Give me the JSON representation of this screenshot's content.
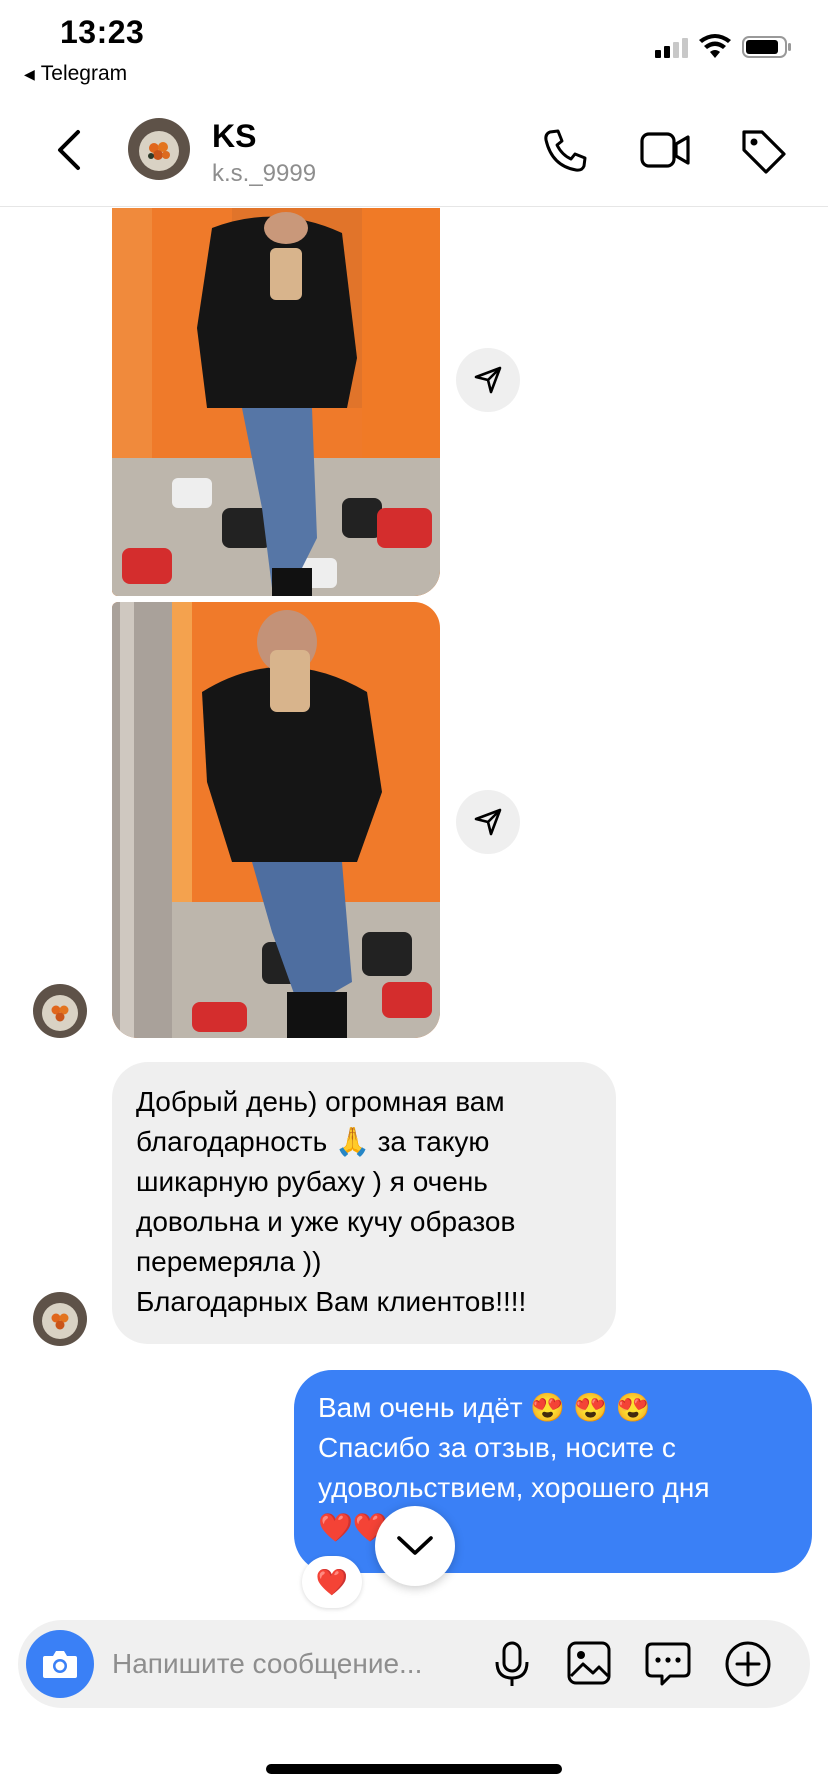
{
  "status_bar": {
    "time": "13:23",
    "back_app": "Telegram"
  },
  "header": {
    "name": "KS",
    "handle": "k.s._9999"
  },
  "messages": {
    "incoming_lines": [
      "Добрый день) огромная вам",
      "благодарность 🙏 за такую",
      "шикарную рубаху ) я очень",
      "довольна и уже кучу образов",
      "перемеряла ))",
      "Благодарных Вам клиентов!!!!"
    ],
    "outgoing_lines": [
      "Вам очень идёт 😍 😍 😍",
      "Спасибо за отзыв, носите с",
      "удовольствием, хорошего дня",
      "❤️❤️❤️"
    ],
    "reaction": "❤️"
  },
  "composer": {
    "placeholder": "Напишите сообщение..."
  },
  "colors": {
    "accent": "#3a80f6",
    "incoming_bubble": "#efefef",
    "muted_text": "#8e8e8e"
  },
  "icons": [
    "back-chevron-icon",
    "phone-icon",
    "video-call-icon",
    "tag-icon",
    "share-icon",
    "chevron-down-icon",
    "camera-icon",
    "microphone-icon",
    "gallery-icon",
    "sticker-chat-icon",
    "plus-circle-icon"
  ]
}
